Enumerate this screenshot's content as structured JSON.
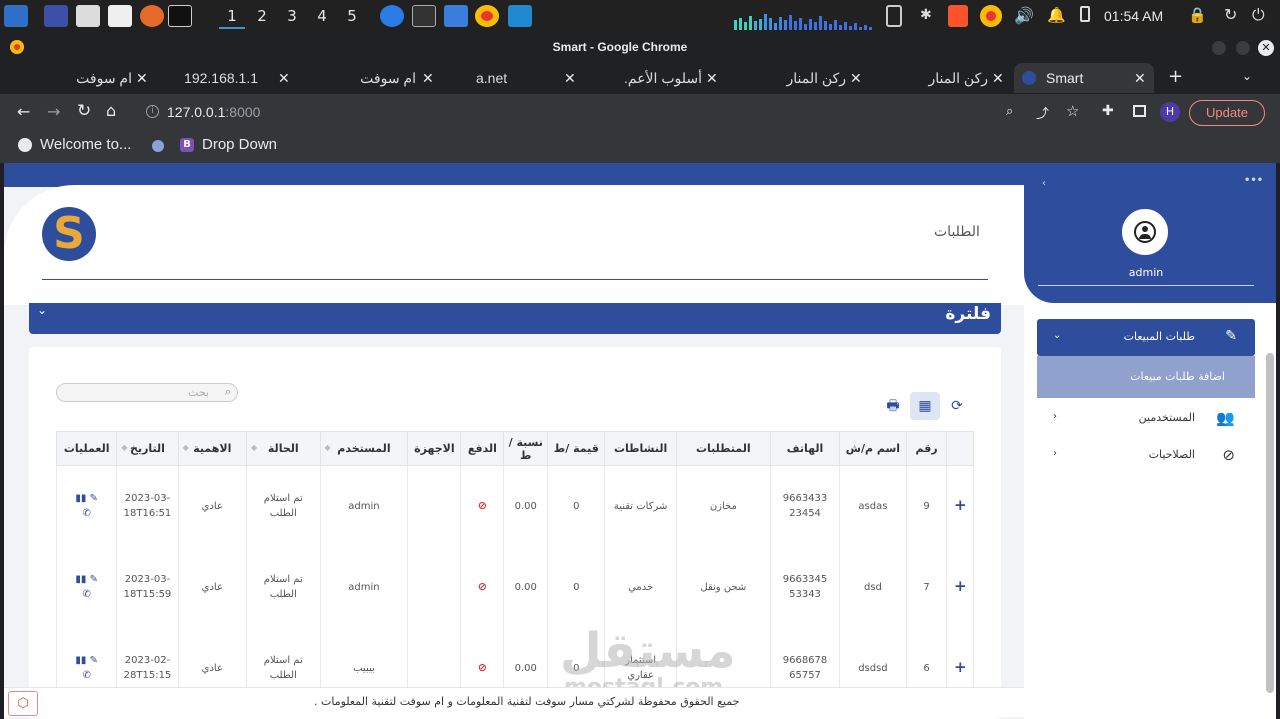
{
  "taskbar": {
    "workspaces": [
      "1",
      "2",
      "3",
      "4",
      "5"
    ],
    "active_workspace": "1",
    "clock": "01:54 AM"
  },
  "browser": {
    "window_title": "Smart - Google Chrome",
    "tabs": [
      {
        "label": "ام سوفت"
      },
      {
        "label": "192.168.1.1"
      },
      {
        "label": "ام سوفت"
      },
      {
        "label": "a.net"
      },
      {
        "label": "أسلوب الأعم."
      },
      {
        "label": "ركن المنار"
      },
      {
        "label": "ركن المنار"
      },
      {
        "label": "Smart"
      }
    ],
    "url_host": "127.0.0.1",
    "url_port": ":8000",
    "update_label": "Update",
    "profile_initial": "H",
    "bookmarks": [
      "Welcome to...",
      "Drop Down"
    ]
  },
  "header": {
    "page_title": "الطلبات",
    "logo_letter": "S"
  },
  "filter": {
    "label": "فلترة"
  },
  "search": {
    "placeholder": "بحث"
  },
  "table": {
    "headers": [
      "رقم",
      "اسم م/ش",
      "الهاتف",
      "المتطلبات",
      "النشاطات",
      "قيمة /ط",
      "نسبة /ط",
      "الدفع",
      "الاجهزة",
      "المستخدم",
      "الحالة",
      "الاهمية",
      "التاريخ",
      "العمليات"
    ],
    "rows": [
      {
        "num": "9",
        "name": "asdas",
        "phone": "9663433 23454",
        "req": "مخازن",
        "activity": "شركات تقنية",
        "value": "0",
        "ratio": "0.00",
        "device": "",
        "user": "admin",
        "status": "تم استلام الطلب",
        "priority": "عادي",
        "date": "2023-03-18T16:51"
      },
      {
        "num": "7",
        "name": "dsd",
        "phone": "9663345 53343",
        "req": "شحن ونقل",
        "activity": "خدمي",
        "value": "0",
        "ratio": "0.00",
        "device": "",
        "user": "admin",
        "status": "تم استلام الطلب",
        "priority": "عادي",
        "date": "2023-03-18T15:59"
      },
      {
        "num": "6",
        "name": "dsdsd",
        "phone": "9668678 65757",
        "req": "",
        "activity": "استثمار عقاري",
        "value": "0",
        "ratio": "0.00",
        "device": "",
        "user": "بيبيب",
        "status": "تم استلام الطلب",
        "priority": "عادي",
        "date": "2023-02-28T15:15"
      }
    ]
  },
  "sidebar": {
    "user": "admin",
    "menu": {
      "sales_requests": "طلبات المبيعات",
      "add_sales_request": "اضافة طلبات مبيعات",
      "users": "المستخدمين",
      "permissions": "الصلاحيات"
    }
  },
  "footer": {
    "text": "جميع الحقوق محفوظة لشركتي مسار سوفت لتقنية المعلومات و ام سوفت لتقنية المعلومات ."
  },
  "watermark": {
    "ar": "مستقل",
    "en": "mostaql.com"
  },
  "colors": {
    "primary": "#2e4d9c",
    "danger": "#d9302f",
    "logo_gold": "#e8a93a"
  }
}
